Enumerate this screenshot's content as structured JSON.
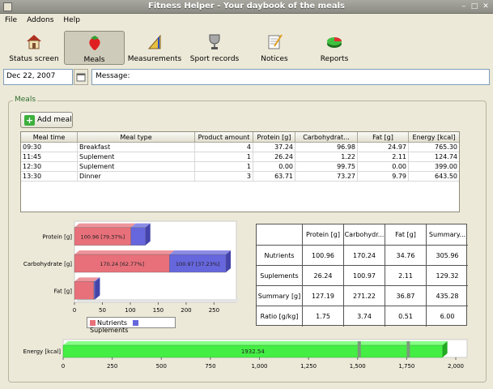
{
  "window": {
    "title": "Fitness Helper - Your daybook of the meals"
  },
  "menu": [
    {
      "label": "File"
    },
    {
      "label": "Addons"
    },
    {
      "label": "Help"
    }
  ],
  "toolbar": [
    {
      "label": "Status screen",
      "icon": "house-icon",
      "active": false
    },
    {
      "label": "Meals",
      "icon": "strawberry-icon",
      "active": true
    },
    {
      "label": "Measurements",
      "icon": "ruler-icon",
      "active": false
    },
    {
      "label": "Sport records",
      "icon": "trophy-icon",
      "active": false
    },
    {
      "label": "Notices",
      "icon": "notepad-icon",
      "active": false
    },
    {
      "label": "Reports",
      "icon": "pie-chart-icon",
      "active": false
    }
  ],
  "date": {
    "value": "Dec 22, 2007"
  },
  "message": {
    "label": "Message:"
  },
  "meals_group": {
    "label": "Meals"
  },
  "add_meal": {
    "label": "Add meal"
  },
  "meals_table": {
    "columns": [
      "Meal time",
      "Meal type",
      "Product amount",
      "Protein [g]",
      "Carbohydrat...",
      "Fat [g]",
      "Energy [kcal]"
    ],
    "rows": [
      [
        "09:30",
        "Breakfast",
        "4",
        "37.24",
        "96.98",
        "24.97",
        "765.30"
      ],
      [
        "11:45",
        "Suplement",
        "1",
        "26.24",
        "1.22",
        "2.11",
        "124.74"
      ],
      [
        "12:30",
        "Suplement",
        "1",
        "0.00",
        "99.75",
        "0.00",
        "399.00"
      ],
      [
        "13:30",
        "Dinner",
        "3",
        "63.71",
        "73.27",
        "9.79",
        "643.50"
      ]
    ]
  },
  "nutrients_chart": {
    "chart_data": {
      "type": "bar",
      "orientation": "horizontal",
      "stacked": true,
      "categories": [
        "Protein [g]",
        "Carbohydrate [g]",
        "Fat [g]"
      ],
      "series": [
        {
          "name": "Nutrients",
          "color": "#e8707a",
          "values": [
            100.96,
            170.24,
            34.76
          ],
          "labels": [
            "100.96 [79.37%]",
            "170.24 [62.77%]",
            ""
          ]
        },
        {
          "name": "Suplements",
          "color": "#6666dd",
          "values": [
            26.24,
            100.97,
            2.11
          ],
          "labels": [
            "",
            "100.97 [37.23%]",
            ""
          ]
        }
      ],
      "xticks": [
        "0",
        "50",
        "100",
        "150",
        "200",
        "250"
      ],
      "xlim": [
        0,
        290
      ],
      "legend": "bottom"
    }
  },
  "stats_table": {
    "columns": [
      "",
      "Protein [g]",
      "Carbohydr...",
      "Fat [g]",
      "Summary..."
    ],
    "rows": [
      [
        "Nutrients",
        "100.96",
        "170.24",
        "34.76",
        "305.96"
      ],
      [
        "Suplements",
        "26.24",
        "100.97",
        "2.11",
        "129.32"
      ],
      [
        "Summary [g]",
        "127.19",
        "271.22",
        "36.87",
        "435.28"
      ],
      [
        "Ratio [g/kg]",
        "1.75",
        "3.74",
        "0.51",
        "6.00"
      ]
    ]
  },
  "energy_chart": {
    "chart_data": {
      "type": "bar",
      "orientation": "horizontal",
      "categories": [
        "Energy [kcal]"
      ],
      "series": [
        {
          "name": "Energy",
          "color": "#44ee44",
          "values": [
            1932.54
          ],
          "labels": [
            "1932.54"
          ]
        }
      ],
      "xticks": [
        "0",
        "250",
        "500",
        "750",
        "1,000",
        "1,250",
        "1,500",
        "1,750",
        "2,000"
      ],
      "xlim": [
        0,
        2000
      ],
      "markers": [
        1500,
        1750
      ]
    }
  }
}
